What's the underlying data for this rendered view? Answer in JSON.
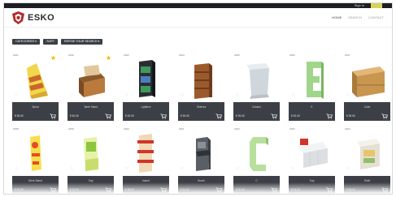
{
  "topbar": {
    "login_label": "Sign in"
  },
  "header": {
    "brand": "ESKO",
    "brand_suffix": "O",
    "nav": [
      "HOME",
      "SEARCH",
      "CONTACT"
    ]
  },
  "toolbar": {
    "buttons": [
      "CATEGORIES ▾",
      "SORT",
      "REFINE YOUR SEARCH ▾"
    ]
  },
  "products": [
    {
      "code": "2391",
      "name": "Spiral",
      "price": "€ 35.00",
      "starred": true,
      "icon": "cardboard-tiered-display"
    },
    {
      "code": "2392",
      "name": "Table Stand",
      "price": "€ 40.00",
      "starred": true,
      "icon": "cardboard-counter-display"
    },
    {
      "code": "2393",
      "name": "Lightbox",
      "price": "€ 45.00",
      "starred": false,
      "icon": "dark-tower-display"
    },
    {
      "code": "2394",
      "name": "Shelves",
      "price": "€ 30.00",
      "starred": false,
      "icon": "brown-shelf-display"
    },
    {
      "code": "2395",
      "name": "Column",
      "price": "€ 25.00",
      "starred": false,
      "icon": "white-pedestal-display"
    },
    {
      "code": "2396",
      "name": "E",
      "price": "€ 20.00",
      "starred": false,
      "icon": "green-letter-display"
    },
    {
      "code": "2397",
      "name": "Cube",
      "price": "€ 28.00",
      "starred": false,
      "icon": "kraft-box-display"
    },
    {
      "code": "2398",
      "name": "Drink Stand",
      "price": "€ 32.00",
      "starred": false,
      "icon": "yellow-bottle-display"
    },
    {
      "code": "2399",
      "name": "Tray",
      "price": "€ 22.00",
      "starred": false,
      "icon": "green-floor-display"
    },
    {
      "code": "2400",
      "name": "Island",
      "price": "€ 38.00",
      "starred": false,
      "icon": "red-shelf-display"
    },
    {
      "code": "2401",
      "name": "Booth",
      "price": "€ 42.00",
      "starred": false,
      "icon": "grey-kiosk-display"
    },
    {
      "code": "2402",
      "name": "C",
      "price": "€ 20.00",
      "starred": false,
      "icon": "green-c-display"
    },
    {
      "code": "2403",
      "name": "Tray",
      "price": "€ 18.00",
      "starred": false,
      "icon": "white-tray-display"
    },
    {
      "code": "2404",
      "name": "Shelf",
      "price": "€ 24.00",
      "starred": false,
      "icon": "white-counter-display"
    }
  ],
  "colors": {
    "accent": "#c9c23a",
    "bar": "#3c4046",
    "star": "#f0b400"
  }
}
